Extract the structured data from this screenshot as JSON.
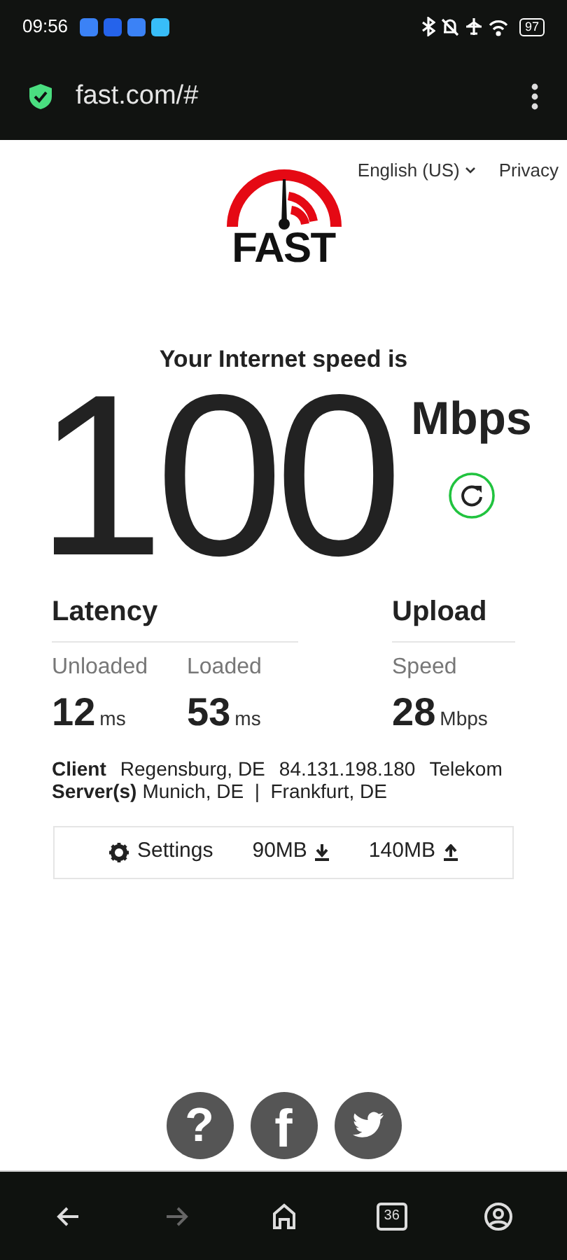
{
  "status_bar": {
    "time": "09:56",
    "battery": "97"
  },
  "address_bar": {
    "url": "fast.com/#"
  },
  "header": {
    "language": "English (US)",
    "privacy": "Privacy"
  },
  "logo": {
    "text": "FAST"
  },
  "speed": {
    "caption": "Your Internet speed is",
    "value": "100",
    "unit": "Mbps"
  },
  "latency": {
    "title": "Latency",
    "metrics": [
      {
        "label": "Unloaded",
        "value": "12",
        "unit": "ms"
      },
      {
        "label": "Loaded",
        "value": "53",
        "unit": "ms"
      }
    ]
  },
  "upload": {
    "title": "Upload",
    "metrics": [
      {
        "label": "Speed",
        "value": "28",
        "unit": "Mbps"
      }
    ]
  },
  "client": {
    "label": "Client",
    "location": "Regensburg, DE",
    "ip": "84.131.198.180",
    "isp": "Telekom"
  },
  "servers": {
    "label": "Server(s)",
    "text": "Munich, DE  |  Frankfurt, DE"
  },
  "settings_bar": {
    "settings": "Settings",
    "download": "90MB",
    "upload": "140MB"
  },
  "footer": {
    "help": "?",
    "facebook": "f"
  },
  "nav": [
    {
      "kind": "back",
      "disabled": false
    },
    {
      "kind": "forward",
      "disabled": true
    },
    {
      "kind": "home",
      "disabled": false
    },
    {
      "kind": "tabs",
      "disabled": false,
      "count": "36"
    },
    {
      "kind": "account",
      "disabled": false
    }
  ]
}
